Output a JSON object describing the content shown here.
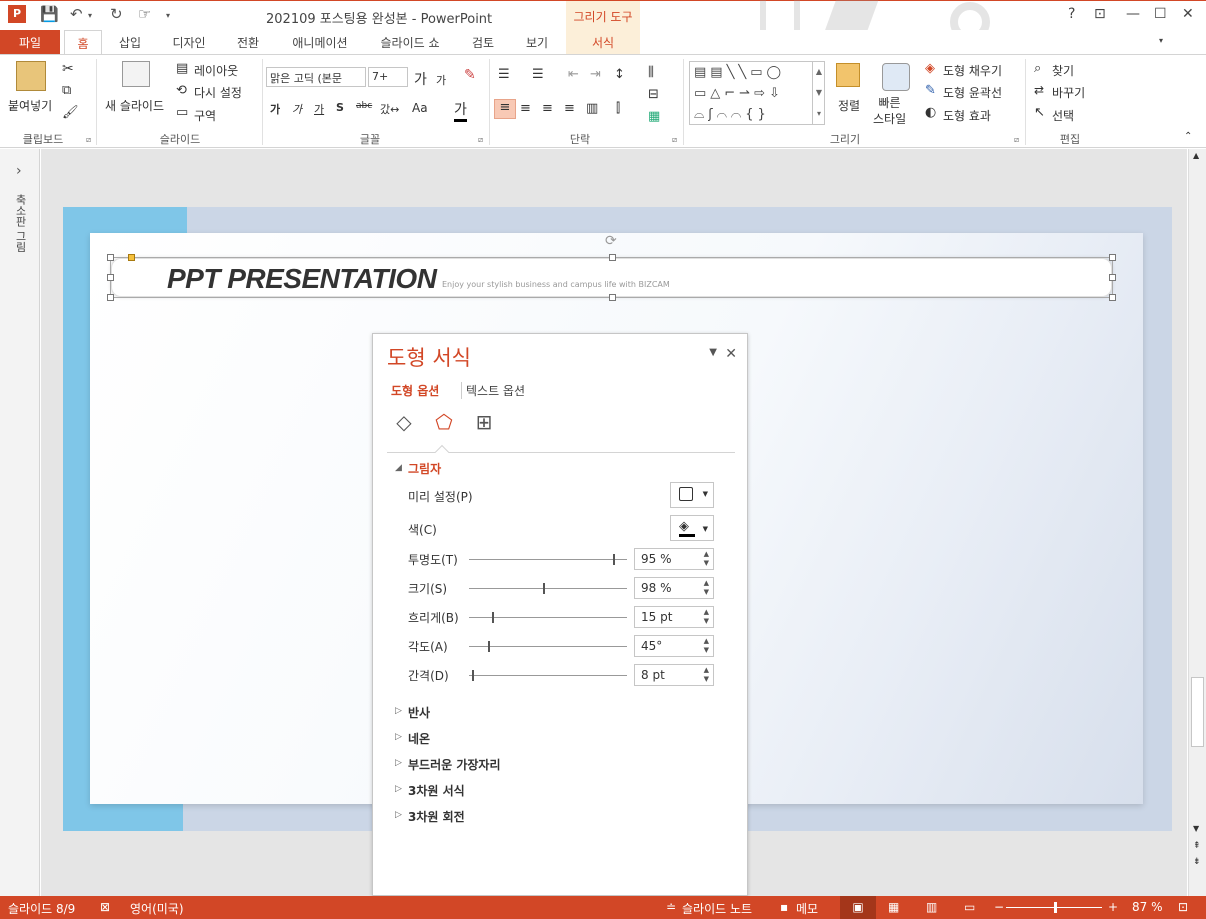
{
  "window": {
    "title": "202109 포스팅용 완성본 - PowerPoint",
    "context_header": "그리기 도구",
    "help": "?",
    "app_icon": "powerpoint-icon"
  },
  "tabs": [
    "파일",
    "홈",
    "삽입",
    "디자인",
    "전환",
    "애니메이션",
    "슬라이드 쇼",
    "검토",
    "보기",
    "서식"
  ],
  "ribbon": {
    "clipboard": {
      "paste": "붙여넣기",
      "label": "클립보드"
    },
    "slides": {
      "new_slide": "새 슬라이드",
      "layout": "레이아웃",
      "reset": "다시 설정",
      "section": "구역",
      "label": "슬라이드"
    },
    "font": {
      "name": "맑은 고딕 (본문",
      "size": "7+",
      "label": "글꼴",
      "change_case": "Aa",
      "spacing": "가"
    },
    "paragraph": {
      "label": "단락"
    },
    "drawing": {
      "arrange": "정렬",
      "quick_styles": "빠른\n스타일",
      "fill": "도형 채우기",
      "outline": "도형 윤곽선",
      "effects": "도형 효과",
      "label": "그리기"
    },
    "editing": {
      "find": "찾기",
      "replace": "바꾸기",
      "select": "선택",
      "label": "편집"
    }
  },
  "left_pane": {
    "label": "축소판 그림",
    "expand": "›"
  },
  "slide": {
    "title": "PPT PRESENTATION",
    "subtitle": "Enjoy your stylish business and campus life with BIZCAM"
  },
  "format_pane": {
    "title": "도형 서식",
    "tab_shape": "도형 옵션",
    "tab_text": "텍스트 옵션",
    "section_shadow": "그림자",
    "preset_label": "미리 설정(P)",
    "color_label": "색(C)",
    "rows": [
      {
        "label": "투명도(T)",
        "value": "95 %",
        "level": 0.95
      },
      {
        "label": "크기(S)",
        "value": "98 %",
        "level": 0.49
      },
      {
        "label": "흐리게(B)",
        "value": "15 pt",
        "level": 0.15
      },
      {
        "label": "각도(A)",
        "value": "45°",
        "level": 0.125
      },
      {
        "label": "간격(D)",
        "value": "8 pt",
        "level": 0.02
      }
    ],
    "collapsed_sections": [
      "반사",
      "네온",
      "부드러운 가장자리",
      "3차원 서식",
      "3차원 회전"
    ]
  },
  "status": {
    "slide_num": "슬라이드 8/9",
    "language": "영어(미국)",
    "notes": "슬라이드 노트",
    "comments": "메모",
    "zoom": "87 %",
    "zoom_level": 0.52
  },
  "colors": {
    "accent": "#d24726",
    "context": "#fcefd9",
    "slide_blue": "#7fc6e8"
  }
}
